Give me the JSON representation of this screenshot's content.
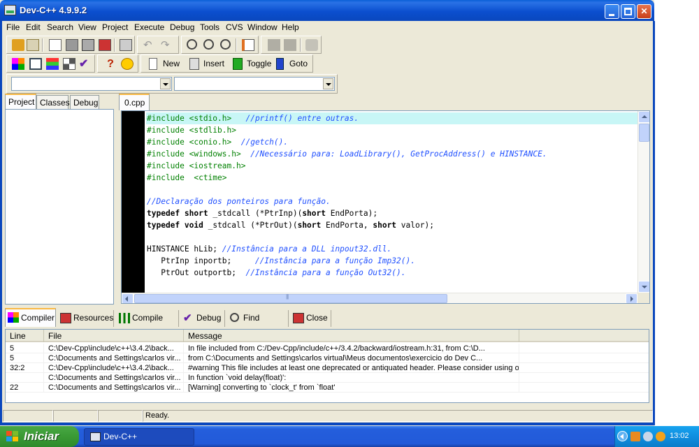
{
  "window": {
    "title": "Dev-C++ 4.9.9.2"
  },
  "menu": [
    "File",
    "Edit",
    "Search",
    "View",
    "Project",
    "Execute",
    "Debug",
    "Tools",
    "CVS",
    "Window",
    "Help"
  ],
  "toolbar": {
    "new_label": "New",
    "insert_label": "Insert",
    "toggle_label": "Toggle",
    "goto_label": "Goto"
  },
  "combos": {
    "left_value": "",
    "right_value": ""
  },
  "left_tabs": [
    "Project",
    "Classes",
    "Debug"
  ],
  "editor": {
    "file_tab": "0.cpp",
    "lines": [
      [
        {
          "t": "#include <stdio.h>",
          "c": "dir"
        },
        {
          "t": "   ",
          "c": ""
        },
        {
          "t": "//printf() entre outras.",
          "c": "com"
        }
      ],
      [
        {
          "t": "#include <stdlib.h>",
          "c": "dir"
        }
      ],
      [
        {
          "t": "#include <conio.h>",
          "c": "dir"
        },
        {
          "t": "  ",
          "c": ""
        },
        {
          "t": "//getch().",
          "c": "com"
        }
      ],
      [
        {
          "t": "#include <windows.h>",
          "c": "dir"
        },
        {
          "t": "  ",
          "c": ""
        },
        {
          "t": "//Necessário para: LoadLibrary(), GetProcAddress() e HINSTANCE.",
          "c": "com"
        }
      ],
      [
        {
          "t": "#include <iostream.h>",
          "c": "dir"
        }
      ],
      [
        {
          "t": "#include  <ctime>",
          "c": "dir"
        }
      ],
      [],
      [
        {
          "t": "//Declaração dos ponteiros para função.",
          "c": "com"
        }
      ],
      [
        {
          "t": "typedef",
          "c": "kw"
        },
        {
          "t": " ",
          "c": ""
        },
        {
          "t": "short",
          "c": "kw"
        },
        {
          "t": " _stdcall (*PtrInp)(",
          "c": ""
        },
        {
          "t": "short",
          "c": "kw"
        },
        {
          "t": " EndPorta);",
          "c": ""
        }
      ],
      [
        {
          "t": "typedef",
          "c": "kw"
        },
        {
          "t": " ",
          "c": ""
        },
        {
          "t": "void",
          "c": "kw"
        },
        {
          "t": " _stdcall (*PtrOut)(",
          "c": ""
        },
        {
          "t": "short",
          "c": "kw"
        },
        {
          "t": " EndPorta, ",
          "c": ""
        },
        {
          "t": "short",
          "c": "kw"
        },
        {
          "t": " valor);",
          "c": ""
        }
      ],
      [],
      [
        {
          "t": "HINSTANCE hLib; ",
          "c": ""
        },
        {
          "t": "//Instância para a DLL inpout32.dll.",
          "c": "com"
        }
      ],
      [
        {
          "t": "   PtrInp inportb;     ",
          "c": ""
        },
        {
          "t": "//Instância para a função Imp32().",
          "c": "com"
        }
      ],
      [
        {
          "t": "   PtrOut outportb;  ",
          "c": ""
        },
        {
          "t": "//Instância para a função Out32().",
          "c": "com"
        }
      ],
      []
    ]
  },
  "bottom_tabs": [
    "Compiler",
    "Resources",
    "Compile Log",
    "Debug",
    "Find Results",
    "Close"
  ],
  "messages": {
    "columns": [
      "Line",
      "File",
      "Message"
    ],
    "rows": [
      [
        "5",
        "C:\\Dev-Cpp\\include\\c++\\3.4.2\\back...",
        "In file included from C:/Dev-Cpp/include/c++/3.4.2/backward/iostream.h:31,                from C:\\D..."
      ],
      [
        "5",
        "C:\\Documents and Settings\\carlos vir...",
        "                 from C:\\Documents and Settings\\carlos virtual\\Meus documentos\\exercicio do Dev C..."
      ],
      [
        "32:2",
        "C:\\Dev-Cpp\\include\\c++\\3.4.2\\back...",
        "#warning This file includes at least one deprecated or antiquated header. Please consider using o..."
      ],
      [
        "",
        "C:\\Documents and Settings\\carlos vir...",
        "In function `void delay(float)':"
      ],
      [
        "22",
        "C:\\Documents and Settings\\carlos vir...",
        "[Warning] converting to `clock_t' from `float'"
      ]
    ]
  },
  "status": {
    "text": "Ready."
  },
  "taskbar": {
    "start_label": "Iniciar",
    "task_label": "Dev-C++",
    "clock": "13:02"
  },
  "colors": {
    "title_blue": "#0a5fd7",
    "directive": "#008000",
    "comment": "#2050ff",
    "highlight_line": "#c8f6f6",
    "start_green": "#3a9a34"
  }
}
